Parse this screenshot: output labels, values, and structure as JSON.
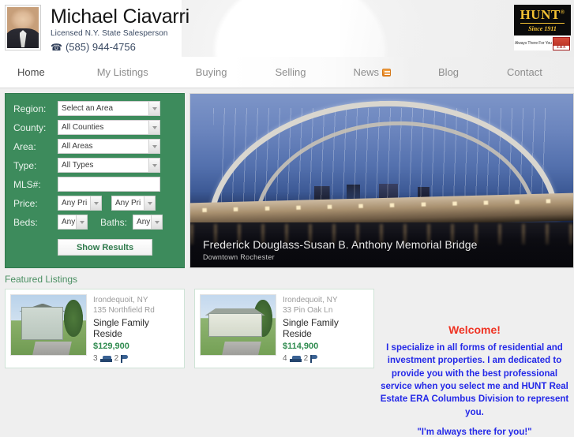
{
  "header": {
    "agent_name": "Michael Ciavarri",
    "agent_title": "Licensed N.Y. State Salesperson",
    "phone": "(585) 944-4756",
    "phone_icon": "telephone-icon",
    "portrait_alt": "agent-portrait",
    "brand": {
      "name": "HUNT",
      "trademark": "®",
      "since": "Since 1911",
      "tagline": "Always There For You",
      "affiliate": "ERA"
    }
  },
  "nav": {
    "items": [
      {
        "label": "Home",
        "active": true
      },
      {
        "label": "My Listings",
        "active": false
      },
      {
        "label": "Buying",
        "active": false
      },
      {
        "label": "Selling",
        "active": false
      },
      {
        "label": "News",
        "active": false,
        "badge": "rss-icon"
      },
      {
        "label": "Blog",
        "active": false
      },
      {
        "label": "Contact",
        "active": false
      }
    ]
  },
  "search": {
    "region_label": "Region:",
    "region_value": "Select an Area",
    "county_label": "County:",
    "county_value": "All Counties",
    "area_label": "Area:",
    "area_value": "All Areas",
    "type_label": "Type:",
    "type_value": "All Types",
    "mls_label": "MLS#:",
    "mls_value": "",
    "price_label": "Price:",
    "price_min_value": "Any Pri",
    "price_max_value": "Any Pri",
    "beds_label": "Beds:",
    "beds_value": "Any",
    "baths_label": "Baths:",
    "baths_value": "Any",
    "submit_label": "Show Results"
  },
  "hero": {
    "title": "Frederick Douglass-Susan B. Anthony Memorial Bridge",
    "subtitle": "Downtown Rochester"
  },
  "featured": {
    "heading": "Featured Listings",
    "listings": [
      {
        "city": "Irondequoit, NY",
        "address": "135 Northfield Rd",
        "type": "Single Family Reside",
        "price": "$129,900",
        "beds": "3",
        "baths": "2"
      },
      {
        "city": "Irondequoit, NY",
        "address": "33 Pin Oak Ln",
        "type": "Single Family Reside",
        "price": "$114,900",
        "beds": "4",
        "baths": "2"
      }
    ]
  },
  "welcome": {
    "title": "Welcome!",
    "body": "I specialize in all forms of residential and investment properties. I am dedicated to provide you with the best professional service when you select me and HUNT Real Estate ERA Columbus Division to represent you.",
    "quote": "\"I'm always there for you!\""
  },
  "colors": {
    "form_green": "#3d8b5c",
    "price_green": "#2f8b4f",
    "heading_green": "#4a8f62",
    "welcome_red": "#ef3323",
    "welcome_blue": "#2328e8",
    "brand_gold": "#f4c233",
    "page_bg": "#efefef"
  }
}
